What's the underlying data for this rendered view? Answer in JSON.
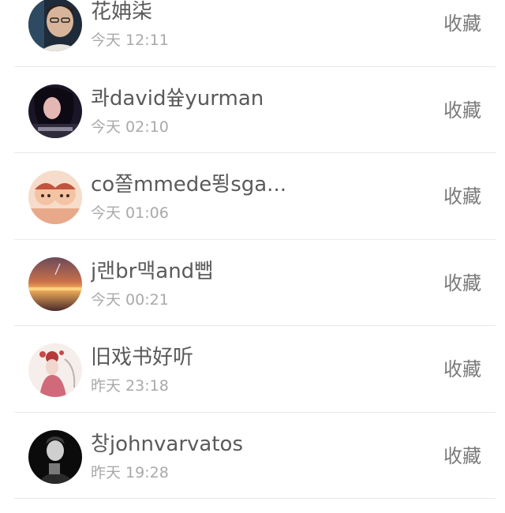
{
  "items": [
    {
      "name": "花姌柒",
      "time": "今天 12:11",
      "action": "收藏",
      "avatar_icon": "avatar-portrait-young-man"
    },
    {
      "name": "콰david쓮yurman",
      "time": "今天 02:10",
      "action": "收藏",
      "avatar_icon": "avatar-woman-dark-hair"
    },
    {
      "name": "co쫄mmede뙹sga...",
      "time": "今天 01:06",
      "action": "收藏",
      "avatar_icon": "avatar-cartoon-pair"
    },
    {
      "name": "j랜br맥and뺍",
      "time": "今天 00:21",
      "action": "收藏",
      "avatar_icon": "avatar-sunset-sea"
    },
    {
      "name": "旧戏书好听",
      "time": "昨天 23:18",
      "action": "收藏",
      "avatar_icon": "avatar-opera-figure"
    },
    {
      "name": "창johnvarvatos",
      "time": "昨天 19:28",
      "action": "收藏",
      "avatar_icon": "avatar-bw-man-portrait"
    }
  ]
}
